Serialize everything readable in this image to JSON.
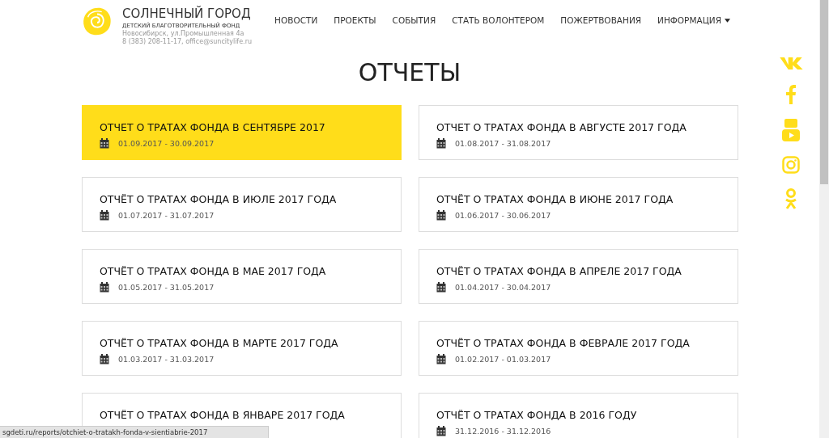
{
  "brand": {
    "name": "СОЛНЕЧНЫЙ ГОРОД",
    "tagline": "ДЕТСКИЙ БЛАГОТВОРИТЕЛЬНЫЙ ФОНД",
    "address": "Новосибирск, ул.Промышленная 4а",
    "contacts": "8 (383) 208-11-17, office@suncitylife.ru"
  },
  "nav": [
    {
      "label": "НОВОСТИ",
      "dropdown": false
    },
    {
      "label": "ПРОЕКТЫ",
      "dropdown": false
    },
    {
      "label": "СОБЫТИЯ",
      "dropdown": false
    },
    {
      "label": "СТАТЬ ВОЛОНТЕРОМ",
      "dropdown": false
    },
    {
      "label": "ПОЖЕРТВОВАНИЯ",
      "dropdown": false
    },
    {
      "label": "ИНФОРМАЦИЯ",
      "dropdown": true
    }
  ],
  "page_title": "ОТЧЕТЫ",
  "reports": [
    {
      "title": "ОТЧЕТ О ТРАТАХ ФОНДА В СЕНТЯБРЕ 2017",
      "dates": "01.09.2017 - 30.09.2017",
      "selected": true
    },
    {
      "title": "ОТЧЕТ О ТРАТАХ ФОНДА В АВГУСТЕ 2017 ГОДА",
      "dates": "01.08.2017 - 31.08.2017",
      "selected": false
    },
    {
      "title": "ОТЧЁТ О ТРАТАХ ФОНДА В ИЮЛЕ 2017 ГОДА",
      "dates": "01.07.2017 - 31.07.2017",
      "selected": false
    },
    {
      "title": "ОТЧЁТ О ТРАТАХ ФОНДА В ИЮНЕ 2017 ГОДА",
      "dates": "01.06.2017 - 30.06.2017",
      "selected": false
    },
    {
      "title": "ОТЧЁТ О ТРАТАХ ФОНДА В МАЕ 2017 ГОДА",
      "dates": "01.05.2017 - 31.05.2017",
      "selected": false
    },
    {
      "title": "ОТЧЁТ О ТРАТАХ ФОНДА В АПРЕЛЕ 2017 ГОДА",
      "dates": "01.04.2017 - 30.04.2017",
      "selected": false
    },
    {
      "title": "ОТЧЁТ О ТРАТАХ ФОНДА В МАРТЕ 2017 ГОДА",
      "dates": "01.03.2017 - 31.03.2017",
      "selected": false
    },
    {
      "title": "ОТЧЁТ О ТРАТАХ ФОНДА В ФЕВРАЛЕ 2017 ГОДА",
      "dates": "01.02.2017 - 01.03.2017",
      "selected": false
    },
    {
      "title": "ОТЧЁТ О ТРАТАХ ФОНДА В ЯНВАРЕ 2017 ГОДА",
      "selected": false
    },
    {
      "title": "ОТЧЁТ О ТРАТАХ ФОНДА В 2016 ГОДУ",
      "dates": "31.12.2016 - 31.12.2016",
      "selected": false
    }
  ],
  "social": [
    {
      "kind": "vk"
    },
    {
      "kind": "facebook"
    },
    {
      "kind": "youtube"
    },
    {
      "kind": "instagram"
    },
    {
      "kind": "odnoklassniki"
    }
  ],
  "status_bar": "sgdeti.ru/reports/otchiet-o-tratakh-fonda-v-sientiabrie-2017"
}
